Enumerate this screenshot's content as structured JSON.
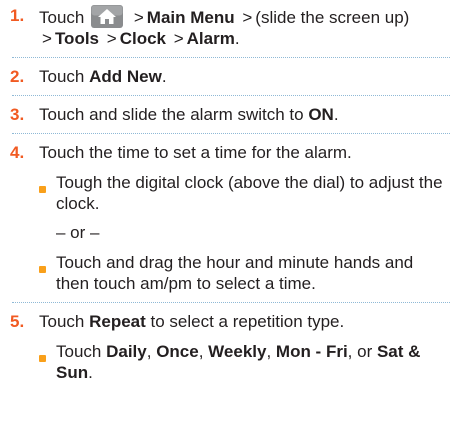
{
  "steps": [
    {
      "number": "1.",
      "touch": "Touch",
      "arrow1": ">",
      "main_menu": "Main Menu",
      "arrow2": ">",
      "slide_note": "(slide the screen up)",
      "arrow3": ">",
      "tools": "Tools",
      "arrow4": ">",
      "clock": "Clock",
      "arrow5": ">",
      "alarm": "Alarm",
      "end": ".",
      "icon": "home-icon"
    },
    {
      "number": "2.",
      "pre": "Touch ",
      "bold": "Add New",
      "post": "."
    },
    {
      "number": "3.",
      "pre": "Touch and slide the alarm switch to ",
      "bold": "ON",
      "post": "."
    },
    {
      "number": "4.",
      "text": "Touch the time to set a time for the alarm.",
      "bullets": [
        "Tough the digital clock (above the dial) to adjust the clock.",
        "Touch and drag the hour and minute hands and then touch am/pm to select a time."
      ],
      "or_text": "– or –"
    },
    {
      "number": "5.",
      "pre": "Touch ",
      "bold": "Repeat",
      "post": " to select a repetition type.",
      "bullet": {
        "pre": "Touch ",
        "daily": "Daily",
        "sep1": ", ",
        "once": "Once",
        "sep2": ", ",
        "weekly": "Weekly",
        "sep3": ", ",
        "monfri": "Mon - Fri",
        "sep4": ", or ",
        "satsun": "Sat & Sun",
        "end": "."
      }
    }
  ],
  "colors": {
    "number": "#f15a22",
    "bullet": "#f9a01b",
    "rule": "#8fb9d6",
    "icon_bg": "#8a8c8e",
    "text": "#231f20"
  }
}
